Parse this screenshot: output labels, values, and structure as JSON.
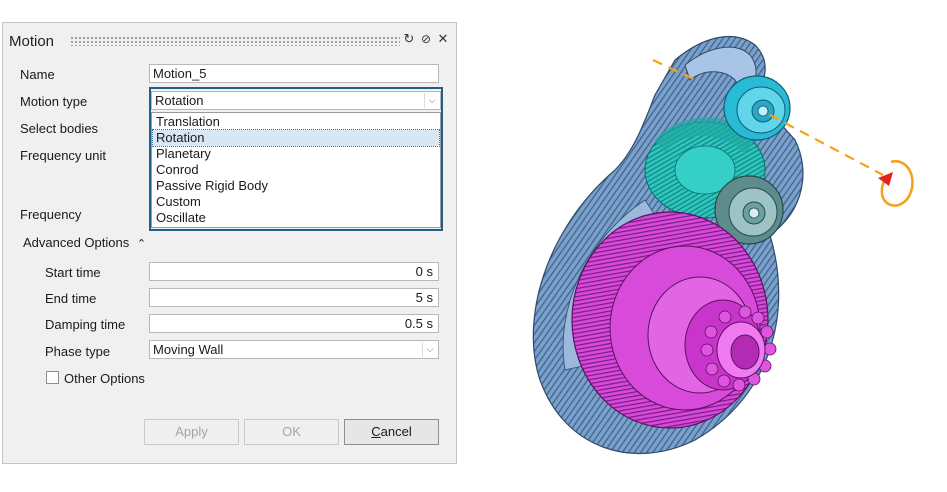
{
  "dialog": {
    "title": "Motion",
    "reset_icon": "reset-icon",
    "help_icon": "help-icon",
    "close_icon": "close-icon"
  },
  "form": {
    "name_label": "Name",
    "name_value": "Motion_5",
    "motion_type_label": "Motion type",
    "motion_type_value": "Rotation",
    "select_bodies_label": "Select bodies",
    "frequency_unit_label": "Frequency unit",
    "frequency_label": "Frequency"
  },
  "motion_type_options": [
    "Translation",
    "Rotation",
    "Planetary",
    "Conrod",
    "Passive Rigid Body",
    "Custom",
    "Oscillate"
  ],
  "motion_type_selected_index": 1,
  "advanced": {
    "toggle_label": "Advanced Options",
    "toggle_icon": "double-chevron-up-icon",
    "start_time_label": "Start time",
    "start_time_value": "0 s",
    "end_time_label": "End time",
    "end_time_value": "5 s",
    "damping_time_label": "Damping time",
    "damping_time_value": "0.5 s",
    "phase_type_label": "Phase type",
    "phase_type_value": "Moving Wall",
    "other_options_label": "Other Options",
    "other_options_checked": false
  },
  "buttons": {
    "apply": "Apply",
    "ok": "OK",
    "cancel_first": "C",
    "cancel_rest": "ancel"
  },
  "colors": {
    "housing": "#6f93c0",
    "gear_magenta": "#d23fd3",
    "bearing_cyan": "#2fc4db",
    "gear_teal": "#27c7bf",
    "rotation_axis": "#f5a21b",
    "arrow_red": "#e0251b",
    "focus_border": "#1f5f85"
  }
}
